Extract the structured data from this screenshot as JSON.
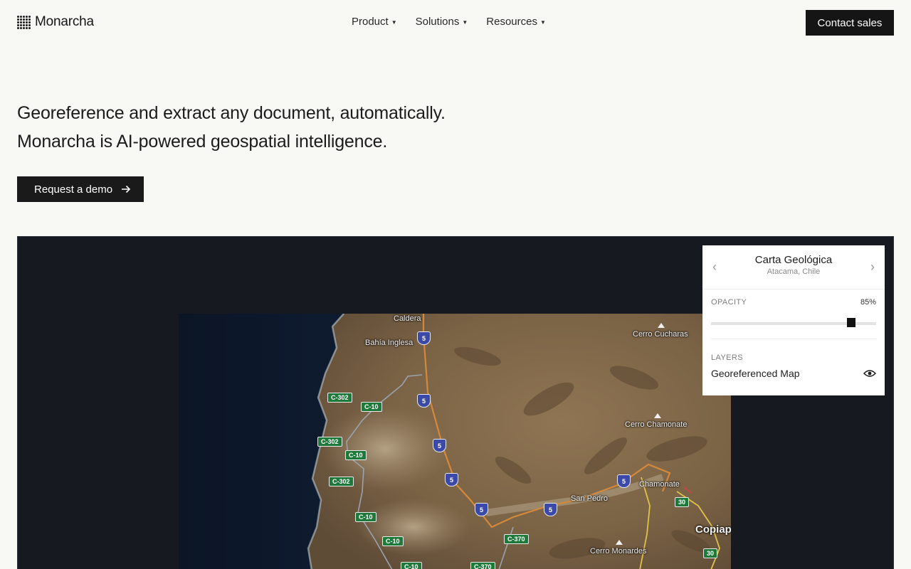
{
  "nav": {
    "brand": "Monarcha",
    "items": [
      {
        "label": "Product"
      },
      {
        "label": "Solutions"
      },
      {
        "label": "Resources"
      }
    ],
    "contact_label": "Contact sales"
  },
  "hero": {
    "line1": "Georeference and extract any document, automatically.",
    "line2": "Monarcha is AI-powered geospatial intelligence.",
    "cta_label": "Request a demo"
  },
  "map": {
    "places": {
      "caldera": "Caldera",
      "bahia_inglesa": "Bahía Inglesa",
      "cerro_cucharas": "Cerro Cucharas",
      "cerro_chamonate": "Cerro Chamonate",
      "chamonate": "Chamonate",
      "san_pedro": "San Pedro",
      "copiapo": "Copiapó",
      "cerro_monardes": "Cerro Monardes"
    },
    "shield_label": "5",
    "routes": {
      "c302": "C-302",
      "c10": "C-10",
      "c370": "C-370",
      "r30": "30"
    }
  },
  "panel": {
    "title": "Carta Geológica",
    "subtitle": "Atacama, Chile",
    "opacity_label": "OPACITY",
    "opacity_value": "85%",
    "opacity_fraction": 0.85,
    "layers_label": "LAYERS",
    "layer_name": "Georeferenced Map"
  },
  "colors": {
    "accent": "#151515",
    "stage": "#161a20",
    "shield": "#3b4aa8",
    "route": "#1e7a3b"
  },
  "icons": [
    "arrow-right-icon",
    "chevron-down-icon",
    "chevron-left-icon",
    "chevron-right-icon",
    "eye-icon",
    "peak-icon"
  ]
}
